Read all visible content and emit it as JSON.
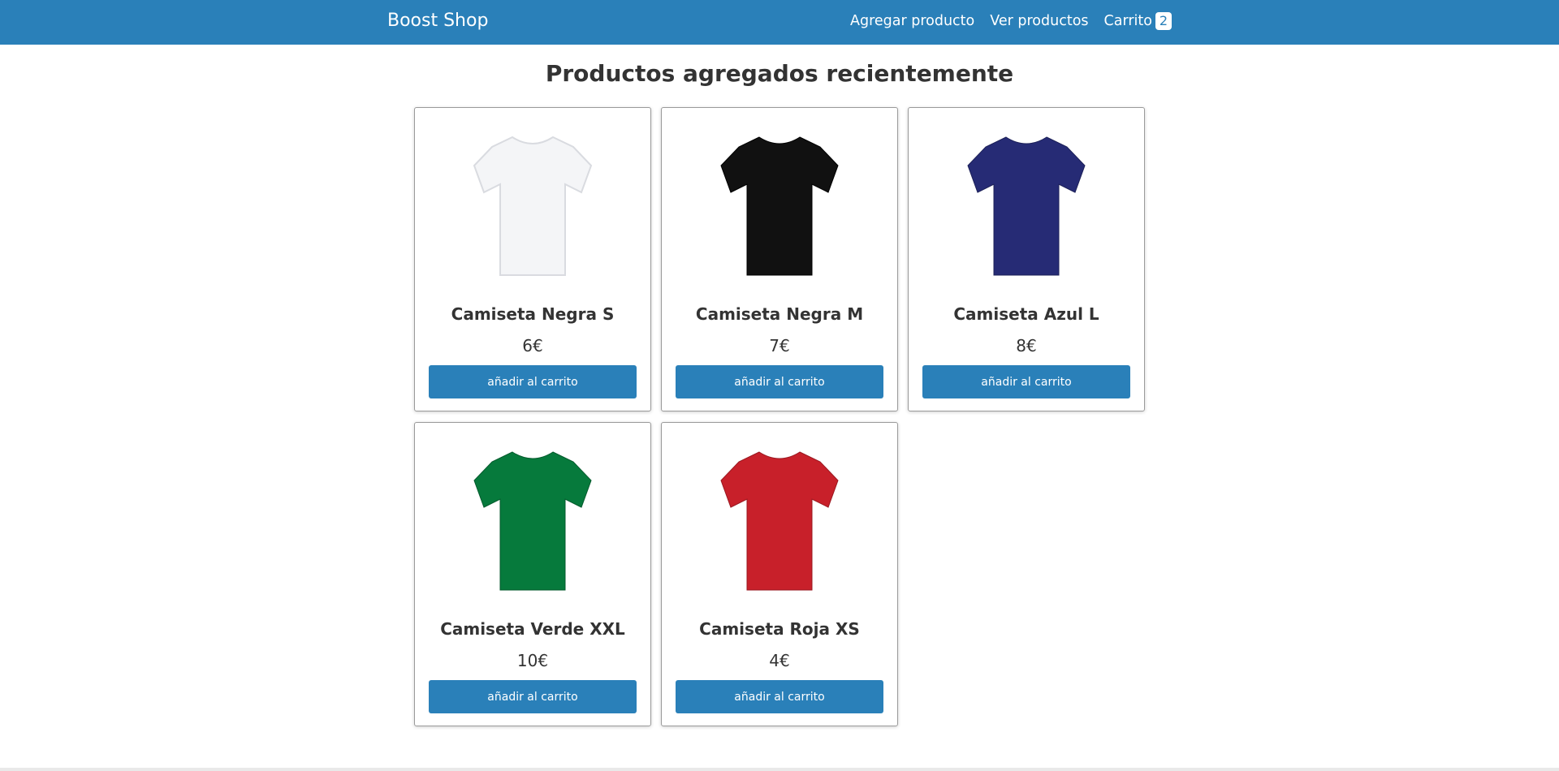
{
  "navbar": {
    "brand": "Boost Shop",
    "links": {
      "add_product": "Agregar producto",
      "view_products": "Ver productos",
      "cart": "Carrito",
      "cart_count": "2"
    },
    "color": "#2a80b9"
  },
  "main": {
    "title": "Productos agregados recientemente",
    "products": [
      {
        "name": "Camiseta Negra S",
        "price": "6€",
        "button": "añadir al carrito",
        "image_icon": "white-tshirt-icon",
        "shirt_color": "#f4f5f7"
      },
      {
        "name": "Camiseta Negra M",
        "price": "7€",
        "button": "añadir al carrito",
        "image_icon": "black-tshirt-icon",
        "shirt_color": "#111111"
      },
      {
        "name": "Camiseta Azul L",
        "price": "8€",
        "button": "añadir al carrito",
        "image_icon": "navy-tshirt-icon",
        "shirt_color": "#262b75"
      },
      {
        "name": "Camiseta Verde XXL",
        "price": "10€",
        "button": "añadir al carrito",
        "image_icon": "green-tshirt-icon",
        "shirt_color": "#067a3c"
      },
      {
        "name": "Camiseta Roja XS",
        "price": "4€",
        "button": "añadir al carrito",
        "image_icon": "red-tshirt-icon",
        "shirt_color": "#c8202a"
      }
    ]
  }
}
